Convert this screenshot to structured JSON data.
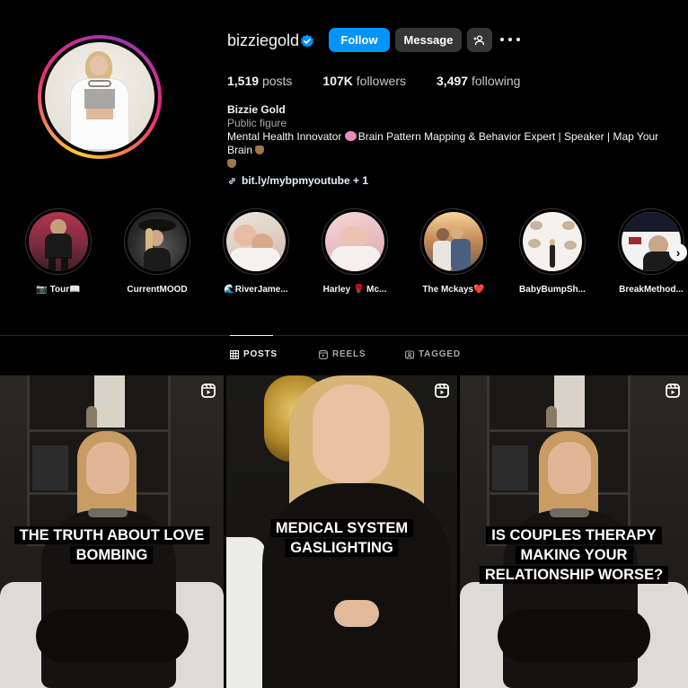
{
  "profile": {
    "username": "bizziegold",
    "follow_label": "Follow",
    "message_label": "Message",
    "stats": {
      "posts_count": "1,519",
      "posts_label": "posts",
      "followers_count": "107K",
      "followers_label": "followers",
      "following_count": "3,497",
      "following_label": "following"
    },
    "bio": {
      "name": "Bizzie Gold",
      "category": "Public figure",
      "desc_before": "Mental Health Innovator",
      "desc_after": "Brain Pattern Mapping & Behavior Expert | Speaker | Map Your Brain",
      "link_text": "bit.ly/mybpmyoutube",
      "link_more": "+ 1"
    }
  },
  "highlights": [
    {
      "label": "📷 Tour📖"
    },
    {
      "label": "CurrentMOOD"
    },
    {
      "label": "🌊RiverJame..."
    },
    {
      "label": "Harley 🌹 Mc..."
    },
    {
      "label": "The Mckays❤️"
    },
    {
      "label": "BabyBumpSh..."
    },
    {
      "label": "BreakMethod..."
    }
  ],
  "tabs": {
    "posts": "POSTS",
    "reels": "REELS",
    "tagged": "TAGGED"
  },
  "posts": [
    {
      "line1": "THE TRUTH ABOUT LOVE",
      "line2": "BOMBING",
      "line3": ""
    },
    {
      "line1": "MEDICAL SYSTEM",
      "line2": "GASLIGHTING",
      "line3": ""
    },
    {
      "line1": "IS COUPLES THERAPY",
      "line2": "MAKING YOUR",
      "line3": "RELATIONSHIP WORSE?"
    }
  ],
  "colors": {
    "background": "#000000",
    "follow_button": "#0095f6",
    "secondary_button": "#363636",
    "verified_badge": "#0095f6"
  }
}
